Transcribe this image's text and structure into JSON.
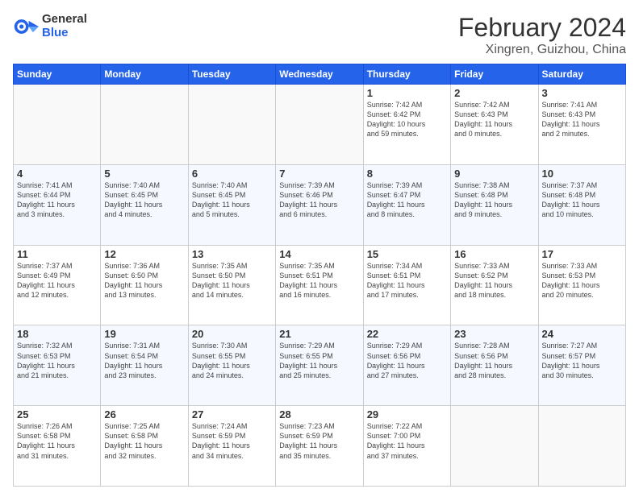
{
  "header": {
    "logo_general": "General",
    "logo_blue": "Blue",
    "month_title": "February 2024",
    "location": "Xingren, Guizhou, China"
  },
  "weekdays": [
    "Sunday",
    "Monday",
    "Tuesday",
    "Wednesday",
    "Thursday",
    "Friday",
    "Saturday"
  ],
  "weeks": [
    [
      {
        "day": "",
        "info": ""
      },
      {
        "day": "",
        "info": ""
      },
      {
        "day": "",
        "info": ""
      },
      {
        "day": "",
        "info": ""
      },
      {
        "day": "1",
        "info": "Sunrise: 7:42 AM\nSunset: 6:42 PM\nDaylight: 10 hours\nand 59 minutes."
      },
      {
        "day": "2",
        "info": "Sunrise: 7:42 AM\nSunset: 6:43 PM\nDaylight: 11 hours\nand 0 minutes."
      },
      {
        "day": "3",
        "info": "Sunrise: 7:41 AM\nSunset: 6:43 PM\nDaylight: 11 hours\nand 2 minutes."
      }
    ],
    [
      {
        "day": "4",
        "info": "Sunrise: 7:41 AM\nSunset: 6:44 PM\nDaylight: 11 hours\nand 3 minutes."
      },
      {
        "day": "5",
        "info": "Sunrise: 7:40 AM\nSunset: 6:45 PM\nDaylight: 11 hours\nand 4 minutes."
      },
      {
        "day": "6",
        "info": "Sunrise: 7:40 AM\nSunset: 6:45 PM\nDaylight: 11 hours\nand 5 minutes."
      },
      {
        "day": "7",
        "info": "Sunrise: 7:39 AM\nSunset: 6:46 PM\nDaylight: 11 hours\nand 6 minutes."
      },
      {
        "day": "8",
        "info": "Sunrise: 7:39 AM\nSunset: 6:47 PM\nDaylight: 11 hours\nand 8 minutes."
      },
      {
        "day": "9",
        "info": "Sunrise: 7:38 AM\nSunset: 6:48 PM\nDaylight: 11 hours\nand 9 minutes."
      },
      {
        "day": "10",
        "info": "Sunrise: 7:37 AM\nSunset: 6:48 PM\nDaylight: 11 hours\nand 10 minutes."
      }
    ],
    [
      {
        "day": "11",
        "info": "Sunrise: 7:37 AM\nSunset: 6:49 PM\nDaylight: 11 hours\nand 12 minutes."
      },
      {
        "day": "12",
        "info": "Sunrise: 7:36 AM\nSunset: 6:50 PM\nDaylight: 11 hours\nand 13 minutes."
      },
      {
        "day": "13",
        "info": "Sunrise: 7:35 AM\nSunset: 6:50 PM\nDaylight: 11 hours\nand 14 minutes."
      },
      {
        "day": "14",
        "info": "Sunrise: 7:35 AM\nSunset: 6:51 PM\nDaylight: 11 hours\nand 16 minutes."
      },
      {
        "day": "15",
        "info": "Sunrise: 7:34 AM\nSunset: 6:51 PM\nDaylight: 11 hours\nand 17 minutes."
      },
      {
        "day": "16",
        "info": "Sunrise: 7:33 AM\nSunset: 6:52 PM\nDaylight: 11 hours\nand 18 minutes."
      },
      {
        "day": "17",
        "info": "Sunrise: 7:33 AM\nSunset: 6:53 PM\nDaylight: 11 hours\nand 20 minutes."
      }
    ],
    [
      {
        "day": "18",
        "info": "Sunrise: 7:32 AM\nSunset: 6:53 PM\nDaylight: 11 hours\nand 21 minutes."
      },
      {
        "day": "19",
        "info": "Sunrise: 7:31 AM\nSunset: 6:54 PM\nDaylight: 11 hours\nand 23 minutes."
      },
      {
        "day": "20",
        "info": "Sunrise: 7:30 AM\nSunset: 6:55 PM\nDaylight: 11 hours\nand 24 minutes."
      },
      {
        "day": "21",
        "info": "Sunrise: 7:29 AM\nSunset: 6:55 PM\nDaylight: 11 hours\nand 25 minutes."
      },
      {
        "day": "22",
        "info": "Sunrise: 7:29 AM\nSunset: 6:56 PM\nDaylight: 11 hours\nand 27 minutes."
      },
      {
        "day": "23",
        "info": "Sunrise: 7:28 AM\nSunset: 6:56 PM\nDaylight: 11 hours\nand 28 minutes."
      },
      {
        "day": "24",
        "info": "Sunrise: 7:27 AM\nSunset: 6:57 PM\nDaylight: 11 hours\nand 30 minutes."
      }
    ],
    [
      {
        "day": "25",
        "info": "Sunrise: 7:26 AM\nSunset: 6:58 PM\nDaylight: 11 hours\nand 31 minutes."
      },
      {
        "day": "26",
        "info": "Sunrise: 7:25 AM\nSunset: 6:58 PM\nDaylight: 11 hours\nand 32 minutes."
      },
      {
        "day": "27",
        "info": "Sunrise: 7:24 AM\nSunset: 6:59 PM\nDaylight: 11 hours\nand 34 minutes."
      },
      {
        "day": "28",
        "info": "Sunrise: 7:23 AM\nSunset: 6:59 PM\nDaylight: 11 hours\nand 35 minutes."
      },
      {
        "day": "29",
        "info": "Sunrise: 7:22 AM\nSunset: 7:00 PM\nDaylight: 11 hours\nand 37 minutes."
      },
      {
        "day": "",
        "info": ""
      },
      {
        "day": "",
        "info": ""
      }
    ]
  ]
}
